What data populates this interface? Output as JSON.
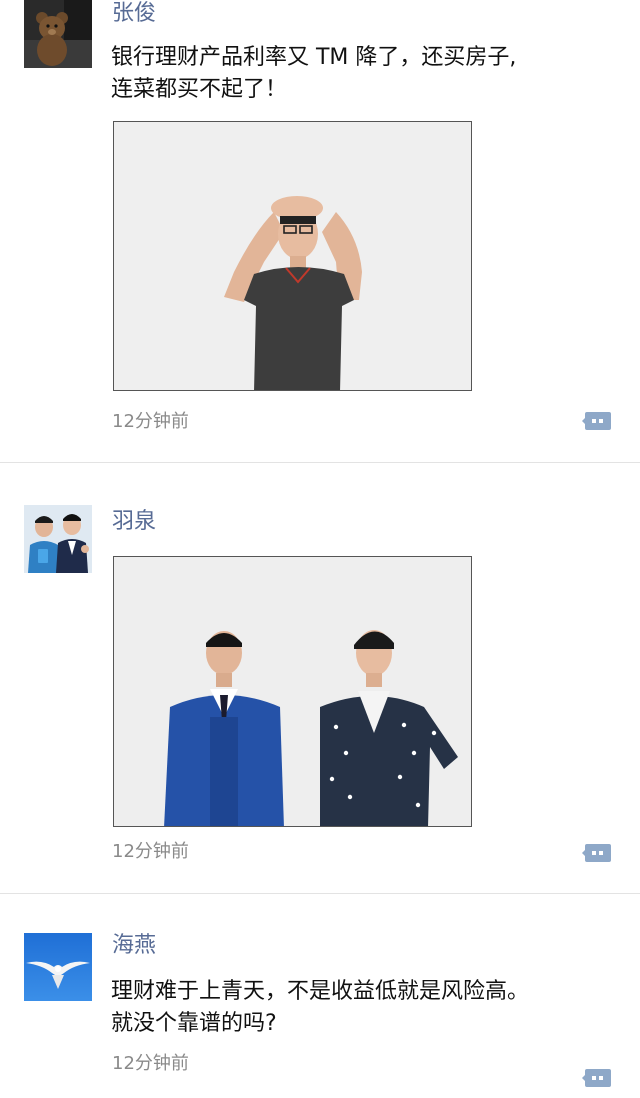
{
  "posts": [
    {
      "author": "张俊",
      "avatar_icon": "teddy-bear-avatar-icon",
      "text_line1": "银行理财产品利率又 TM 降了，还买房子,",
      "text_line2": "连菜都买不起了！",
      "photo": "man-hands-on-head-photo",
      "time": "12分钟前",
      "comment_icon": "comment-bubble-icon"
    },
    {
      "author": "羽泉",
      "avatar_icon": "two-men-avatar-icon",
      "photo": "two-men-standing-photo",
      "time": "12分钟前",
      "comment_icon": "comment-bubble-icon"
    },
    {
      "author": "海燕",
      "avatar_icon": "seagull-avatar-icon",
      "text_line1": "理财难于上青天，不是收益低就是风险高。",
      "text_line2": "就没个靠谱的吗?",
      "time": "12分钟前",
      "comment_icon": "comment-bubble-icon"
    }
  ],
  "colors": {
    "name": "#576b95",
    "time": "#8a8a8a",
    "comment_icon": "#8ea8c8",
    "divider": "#e3e3e3"
  }
}
